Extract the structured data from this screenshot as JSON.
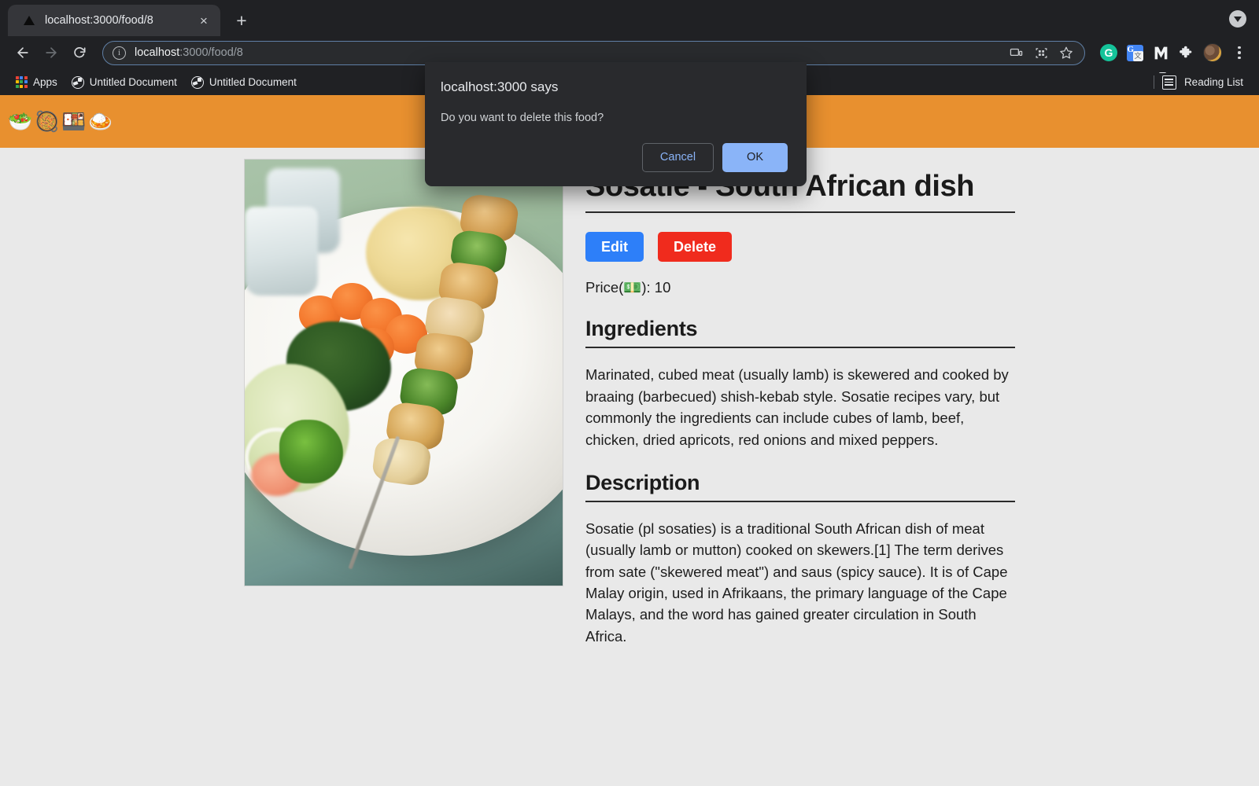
{
  "browser": {
    "tab": {
      "title": "localhost:3000/food/8",
      "close_label": "×",
      "favicon_name": "triangle-favicon"
    },
    "new_tab_label": "+",
    "tab_search_name": "tab-search-button",
    "toolbar": {
      "back_label": "Back",
      "forward_label": "Forward",
      "reload_label": "Reload",
      "url_host": "localhost",
      "url_rest": ":3000/food/8",
      "url_full": "localhost:3000/food/8",
      "info_glyph": "i",
      "icons": {
        "cast": "cast-icon",
        "qr": "qr-code-icon",
        "bookmark_star": "star-icon",
        "grammarly": "G",
        "translate_g": "G",
        "translate_sq": "文",
        "extension_dark": "M",
        "puzzle": "puzzle-icon",
        "avatar": "avatar",
        "menu": "three-dot-menu"
      }
    },
    "bookmarks": {
      "items": [
        {
          "label": "Apps",
          "icon": "apps-grid-icon"
        },
        {
          "label": "Untitled Document",
          "icon": "globe-icon"
        },
        {
          "label": "Untitled Document",
          "icon": "globe-icon"
        }
      ],
      "reading_list_label": "Reading List"
    }
  },
  "dialog": {
    "title": "localhost:3000 says",
    "message": "Do you want to delete this food?",
    "cancel_label": "Cancel",
    "ok_label": "OK",
    "ok_color": "#8ab4f8"
  },
  "site": {
    "navbar_color": "#e8902f",
    "nav_emojis": [
      "🥗",
      "🥘",
      "🍱",
      "🍛"
    ]
  },
  "food": {
    "image_alt": "Sosatie skewer plated with carrots, spinach, mashed potato and salad",
    "title": "Sosatie - South African dish",
    "edit_label": "Edit",
    "delete_label": "Delete",
    "edit_color": "#2d7ff9",
    "delete_color": "#f02b1d",
    "price_label": "Price(💵): 10",
    "price_value": "10",
    "ingredients_heading": "Ingredients",
    "ingredients_text": "Marinated, cubed meat (usually lamb) is skewered and cooked by braaing (barbecued) shish-kebab style. Sosatie recipes vary, but commonly the ingredients can include cubes of lamb, beef, chicken, dried apricots, red onions and mixed peppers.",
    "description_heading": "Description",
    "description_text": "Sosatie (pl sosaties) is a traditional South African dish of meat (usually lamb or mutton) cooked on skewers.[1] The term derives from sate (\"skewered meat\") and saus (spicy sauce). It is of Cape Malay origin, used in Afrikaans, the primary language of the Cape Malays, and the word has gained greater circulation in South Africa."
  }
}
